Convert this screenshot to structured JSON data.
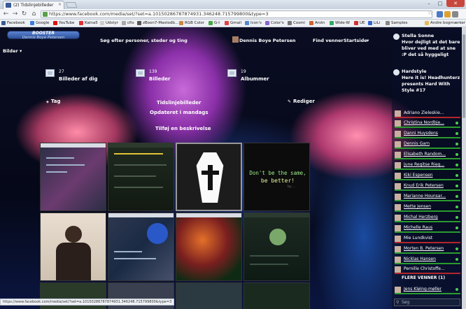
{
  "browser": {
    "tab_title": "(2) Tidslinjebilleder",
    "url": "https://www.facebook.com/media/set/?set=a.10150286787874931.346248.715799800&type=3",
    "status_url": "https://www.facebook.com/media/set/?set=a.10150286787874931.346248.715799800&type=3",
    "bookmarks": [
      "Facebook",
      "Google",
      "YouTube",
      "Kaina5",
      "Udstyr",
      "cfix",
      "zBoon7-Mastodb...",
      "RGB Color",
      "G-I",
      "Gmail",
      "Icon's",
      "Color's",
      "Cosmi",
      "Arstn",
      "Wide-W",
      "UE",
      "LiLi",
      "Samples",
      "Andre bogmærker"
    ]
  },
  "fb": {
    "booster": {
      "title": "BOOSTER",
      "name": "Dennis Boye Petersen"
    },
    "search_placeholder": "Søg efter personer, steder og ting",
    "nav": {
      "user": "Dennis Boye Petersen",
      "find_friends": "Find venner",
      "home": "Startside"
    }
  },
  "photos_menu": "Bilder",
  "albums": [
    {
      "count": "27",
      "label": "Billeder af dig"
    },
    {
      "count": "139",
      "label": "Billeder"
    },
    {
      "count": "19",
      "label": "Albummer"
    }
  ],
  "album_header": {
    "tag": "Tag",
    "edit": "Rediger",
    "title": "Tidslinjebilleder",
    "updated": "Opdateret i mandags",
    "add_description": "Tilføj en beskrivelse"
  },
  "grid_quote": {
    "line1": "Don't be the same,",
    "line2": "be better!",
    "attribution": "by ..."
  },
  "ticker": [
    {
      "name": "Stella Sonne",
      "text": "Hvor dejligt at det bare bliver ved med at sne :P det så hyggeligt"
    },
    {
      "name": "Hardstyle",
      "text": "Here it is! Headhunterz presents Hard With Style #17"
    }
  ],
  "friends": [
    {
      "name": "Adriano Zieleskie...",
      "online": false
    },
    {
      "name": "Christina Nordbje...",
      "online": true
    },
    {
      "name": "Danni Huysdens",
      "online": true
    },
    {
      "name": "Dennis Garn",
      "online": true
    },
    {
      "name": "Elisabeth Random...",
      "online": true
    },
    {
      "name": "June Regitse Rieg...",
      "online": true
    },
    {
      "name": "Kiki Espensen",
      "online": true
    },
    {
      "name": "Knud Erik Petersen",
      "online": true
    },
    {
      "name": "Marianne Hounsar...",
      "online": true
    },
    {
      "name": "Mette Jensen",
      "online": true
    },
    {
      "name": "Michal Herzberg",
      "online": true
    },
    {
      "name": "Michelle Raus",
      "online": true
    },
    {
      "name": "Mie Lundkvist",
      "online": false
    },
    {
      "name": "Morten B. Petersen",
      "online": true
    },
    {
      "name": "Nicklas Hansen",
      "online": true
    },
    {
      "name": "Pernille Christoffe...",
      "online": false
    },
    {
      "name": "Jens Kløing-møller",
      "online": true
    }
  ],
  "more_friends": "FLERE VENNER (1)",
  "chat_search_placeholder": "Søg"
}
